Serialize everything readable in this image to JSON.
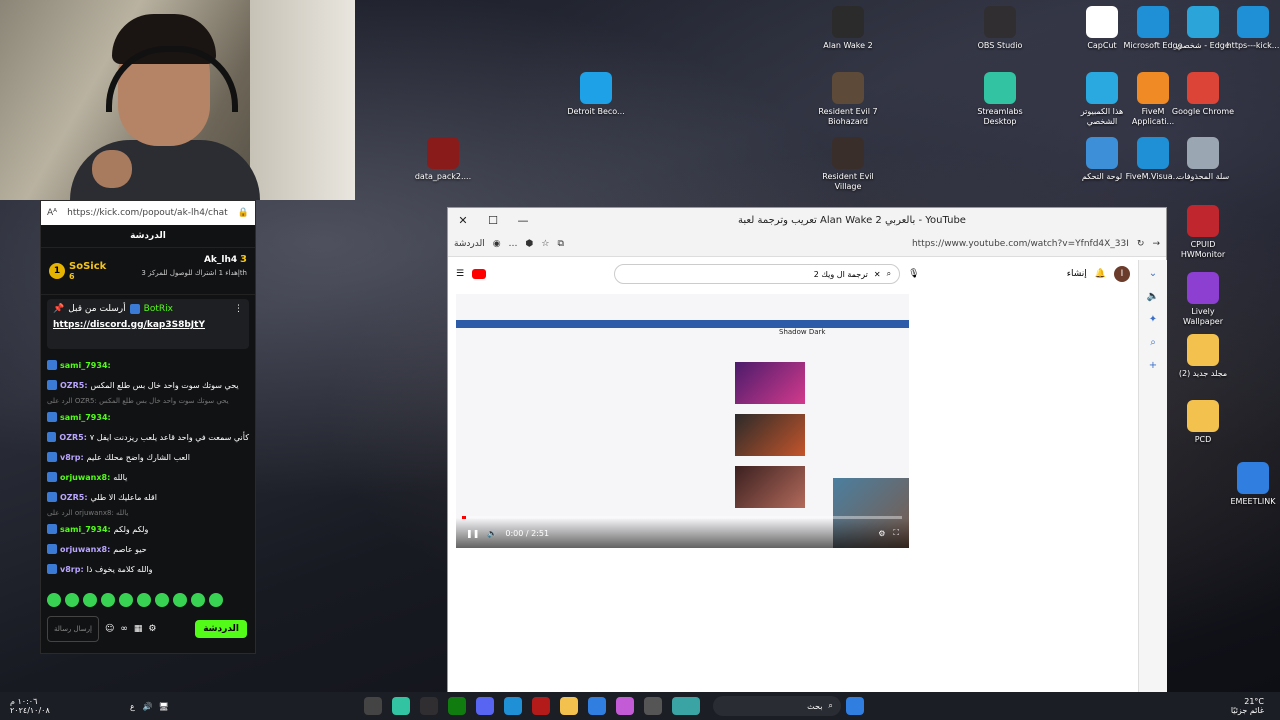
{
  "webcam": {
    "label": "webcam-overlay"
  },
  "chat": {
    "url": "https://kick.com/popout/ak-lh4/chat",
    "header": "الدردشة",
    "leaderboard": [
      {
        "rank": "1",
        "name": "SoSick",
        "count": "6"
      },
      {
        "name": "Ak_lh4",
        "count": "3",
        "note": "إهداء 1 اشتراك للوصول للمركز",
        "place": "3th"
      }
    ],
    "pinned": {
      "title": "أرسلت من قبل",
      "user": "BotRix",
      "link": "https://discord.gg/kap3S8bJtY"
    },
    "messages": [
      {
        "user": "sami_7934:",
        "text": ""
      },
      {
        "user": "OZR5:",
        "text": "يحي سوتك سوت واحد خال بس طلع المكس"
      },
      {
        "reply": "الرد على OZR5: يحي سوتك سوت واحد خال بس طلع المكس"
      },
      {
        "user": "sami_7934:",
        "text": ""
      },
      {
        "user": "OZR5:",
        "text": "كأني سمعت في واحد قاعد يلعب ريزدنت ايفل ٧"
      },
      {
        "user": "v8rp:",
        "text": "العب الشارك واضح محلك عليم"
      },
      {
        "user": "orjuwanx8:",
        "text": "يالله"
      },
      {
        "user": "OZR5:",
        "text": "اقله ماعليك الا طلي"
      },
      {
        "reply": "الرد على orjuwanx8: يالله"
      },
      {
        "user": "sami_7934:",
        "text": "ولكم ولكم"
      },
      {
        "user": "orjuwanx8:",
        "text": "حيو عاصم"
      },
      {
        "user": "v8rp:",
        "text": "والله كلامة يخوف ذا"
      }
    ],
    "input_placeholder": "إرسال رسالة",
    "send_label": "الدردشة"
  },
  "desktop_icons": [
    {
      "label": "Alan Wake 2",
      "color": "#2b2b2b"
    },
    {
      "label": "OBS Studio",
      "color": "#302e31"
    },
    {
      "label": "CapCut",
      "color": "#ffffff"
    },
    {
      "label": "Microsoft Edge",
      "color": "#1f8fd6"
    },
    {
      "label": "شخصي - Edge",
      "color": "#2aa4d9"
    },
    {
      "label": "https---kick...",
      "color": "#1f8fd6"
    },
    {
      "label": "Detroit Beco...",
      "color": "#1ea1e6"
    },
    {
      "label": "Resident Evil 7 Biohazard",
      "color": "#5d4a38"
    },
    {
      "label": "Streamlabs Desktop",
      "color": "#31c3a2"
    },
    {
      "label": "هذا الكمبيوتر الشخصي",
      "color": "#29a9e0"
    },
    {
      "label": "FiveM Applicati...",
      "color": "#f08a24"
    },
    {
      "label": "Google Chrome",
      "color": "#db4437"
    },
    {
      "label": "data_pack2....",
      "color": "#8a1b1b"
    },
    {
      "label": "Resident Evil Village",
      "color": "#3a2e2a"
    },
    {
      "label": "لوحة التحكم",
      "color": "#3d8fd8"
    },
    {
      "label": "FiveM.Visua...",
      "color": "#1f8fd6"
    },
    {
      "label": "سلة المحذوفات",
      "color": "#9aa6b2"
    },
    {
      "label": "CPUID HWMonitor",
      "color": "#c0262d"
    },
    {
      "label": "Lively Wallpaper",
      "color": "#8c3fd0"
    },
    {
      "label": "مجلد جديد (2)",
      "color": "#f2c14e"
    },
    {
      "label": "PCD",
      "color": "#f2c14e"
    },
    {
      "label": "EMEETLINK",
      "color": "#2f7ee0"
    }
  ],
  "browser": {
    "title": "تعريب وترجمة لعبة Alan Wake 2 بالعربي - YouTube",
    "url": "https://www.youtube.com/watch?v=Yfnfd4X_33I",
    "tab_label": "الدردشة",
    "search_query": "ترجمة ال ويك 2",
    "create_label": "إنشاء",
    "avatar_letter": "I",
    "video": {
      "site_title": "Shadow Dark",
      "time": "0:00 / 2:51",
      "progress": 0.01
    }
  },
  "taskbar": {
    "search_placeholder": "بحث",
    "weather_temp": "21°C",
    "weather_desc": "غائم جزئيًا",
    "time": "١٠:٠٦ م",
    "date": "٢٠٢٤/١٠/٠٨",
    "lang": "ع"
  }
}
